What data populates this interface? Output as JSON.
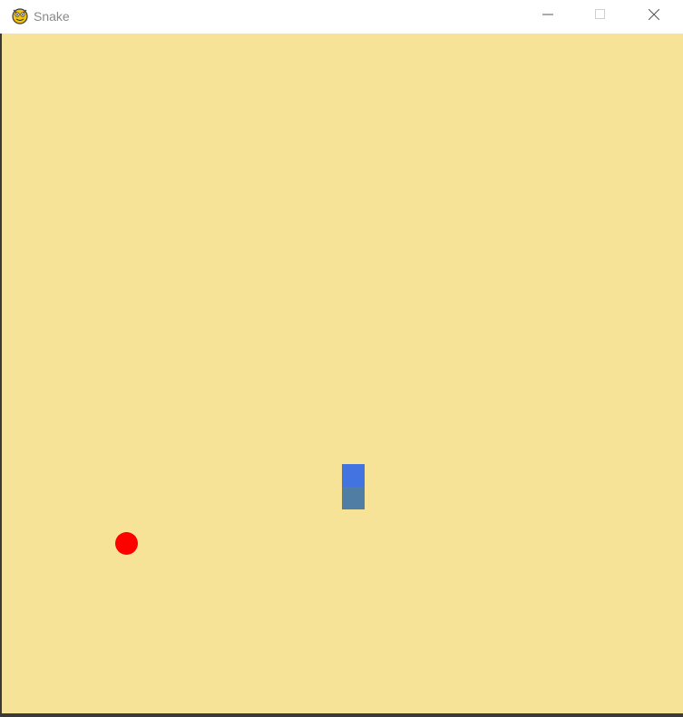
{
  "window": {
    "title": "Snake",
    "icon": "pygame-snake-icon"
  },
  "controls": {
    "minimize_icon": "minimize-icon",
    "maximize_icon": "maximize-icon",
    "close_icon": "close-icon"
  },
  "game": {
    "background_color": "#f6e397",
    "snake": {
      "head_color": "#4273e0",
      "body_color": "#4f7da4",
      "length": 2
    },
    "food": {
      "color": "#ff0000"
    }
  }
}
